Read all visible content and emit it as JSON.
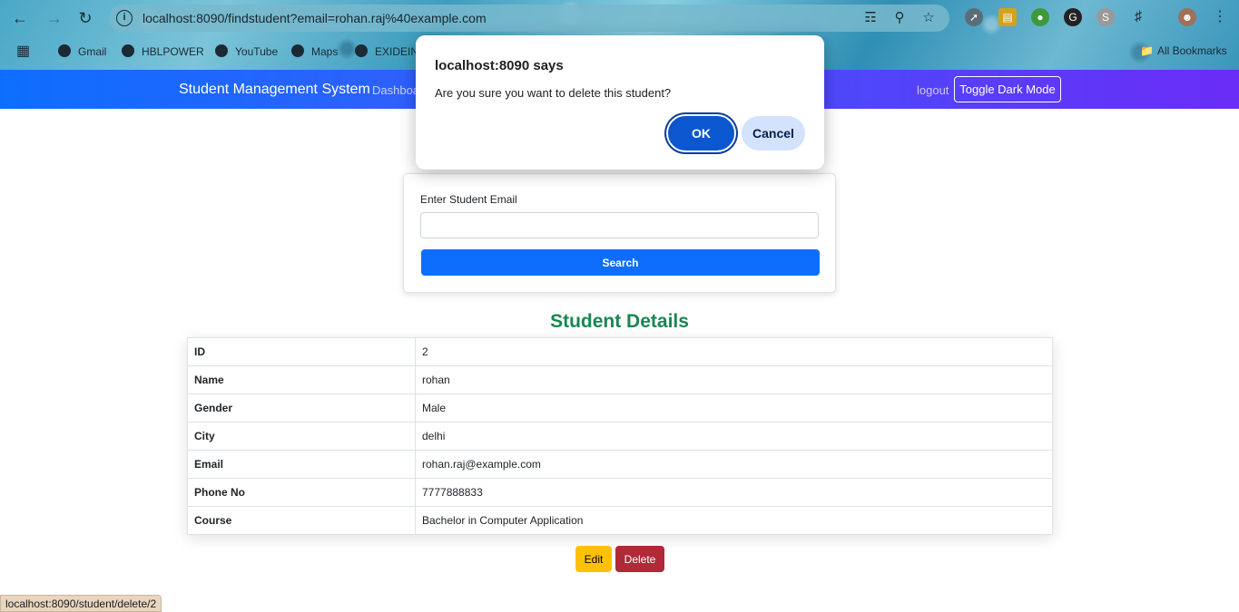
{
  "browser": {
    "url": "localhost:8090/findstudent?email=rohan.raj%40example.com",
    "bookmarks": [
      "Gmail",
      "HBLPOWER",
      "YouTube",
      "Maps",
      "EXIDEIN"
    ],
    "all_bookmarks_label": "All Bookmarks"
  },
  "navbar": {
    "brand": "Student Management System",
    "dashboard_link": "Dashboa",
    "logout_link": "logout",
    "dark_mode_button": "Toggle Dark Mode"
  },
  "search": {
    "label": "Enter Student Email",
    "input_value": "",
    "button_label": "Search"
  },
  "details": {
    "title": "Student Details",
    "rows": [
      {
        "key": "ID",
        "value": "2"
      },
      {
        "key": "Name",
        "value": "rohan"
      },
      {
        "key": "Gender",
        "value": "Male"
      },
      {
        "key": "City",
        "value": "delhi"
      },
      {
        "key": "Email",
        "value": "rohan.raj@example.com"
      },
      {
        "key": "Phone No",
        "value": "7777888833"
      },
      {
        "key": "Course",
        "value": "Bachelor in Computer Application"
      }
    ],
    "edit_label": "Edit",
    "delete_label": "Delete"
  },
  "dialog": {
    "title": "localhost:8090 says",
    "message": "Are you sure you want to delete this student?",
    "ok_label": "OK",
    "cancel_label": "Cancel"
  },
  "status_bar": "localhost:8090/student/delete/2",
  "colors": {
    "primary": "#0d6efd",
    "success_title": "#198754",
    "warning": "#ffc107",
    "danger": "#b02a37",
    "dialog_ok": "#0b57d0"
  }
}
